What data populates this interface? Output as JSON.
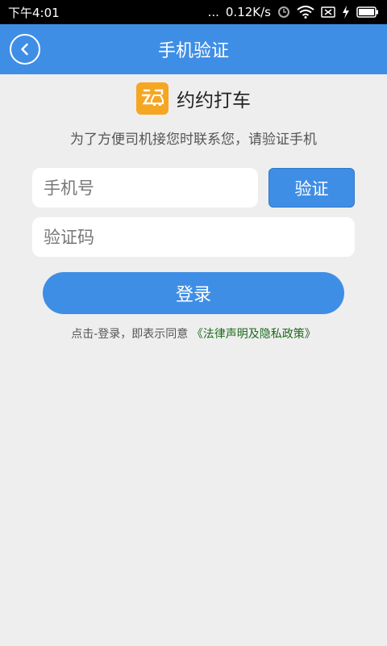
{
  "status_bar": {
    "time": "下午4:01",
    "net_speed": "0.12K/s",
    "dots": "..."
  },
  "header": {
    "title": "手机验证"
  },
  "brand": {
    "name": "约约打车",
    "logo_text": "约",
    "logo_color": "#f5a623"
  },
  "subtitle": "为了方便司机接您时联系您，请验证手机",
  "form": {
    "phone_placeholder": "手机号",
    "code_placeholder": "验证码",
    "verify_label": "验证",
    "login_label": "登录"
  },
  "terms": {
    "prefix": "点击-登录，即表示同意",
    "link": "《法律声明及隐私政策》"
  },
  "colors": {
    "primary": "#3f8ee6",
    "link": "#1d6b1d"
  }
}
